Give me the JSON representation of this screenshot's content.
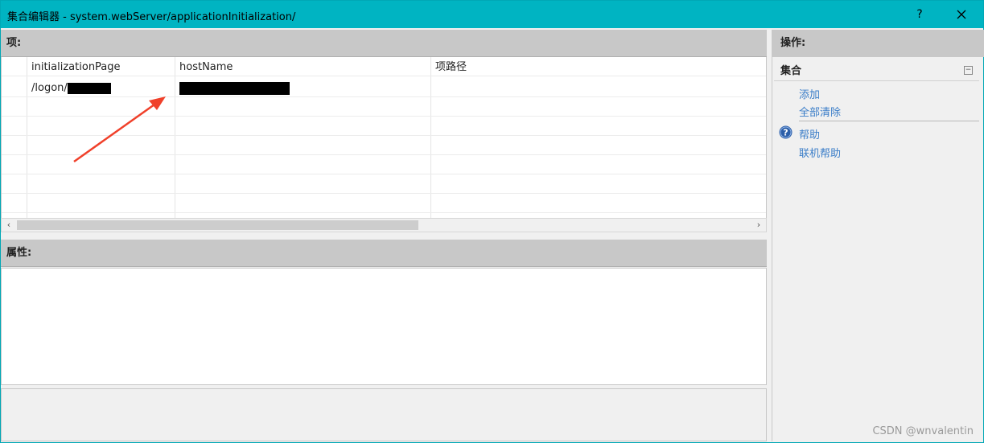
{
  "window": {
    "title": "集合编辑器 - system.webServer/applicationInitialization/",
    "help_label": "?",
    "close_label": "✕"
  },
  "items_section": {
    "header": "项:",
    "columns": [
      "initializationPage",
      "hostName",
      "项路径"
    ],
    "rows": [
      {
        "initializationPage": "/logon/",
        "hostName": "",
        "path": ""
      }
    ]
  },
  "scrollbar": {
    "left_arrow": "‹",
    "right_arrow": "›"
  },
  "properties_section": {
    "header": "属性:"
  },
  "actions_pane": {
    "header": "操作:",
    "group_title": "集合",
    "collapse_glyph": "−",
    "links": {
      "add": "添加",
      "clear_all": "全部清除",
      "help": "帮助",
      "online_help": "联机帮助"
    }
  },
  "annotation": {
    "arrow_color": "#f0402a"
  },
  "watermark": "CSDN @wnvalentin",
  "colors": {
    "titlebar": "#00b4c2",
    "header_bar": "#c8c8c8",
    "link": "#3a7dc8"
  }
}
